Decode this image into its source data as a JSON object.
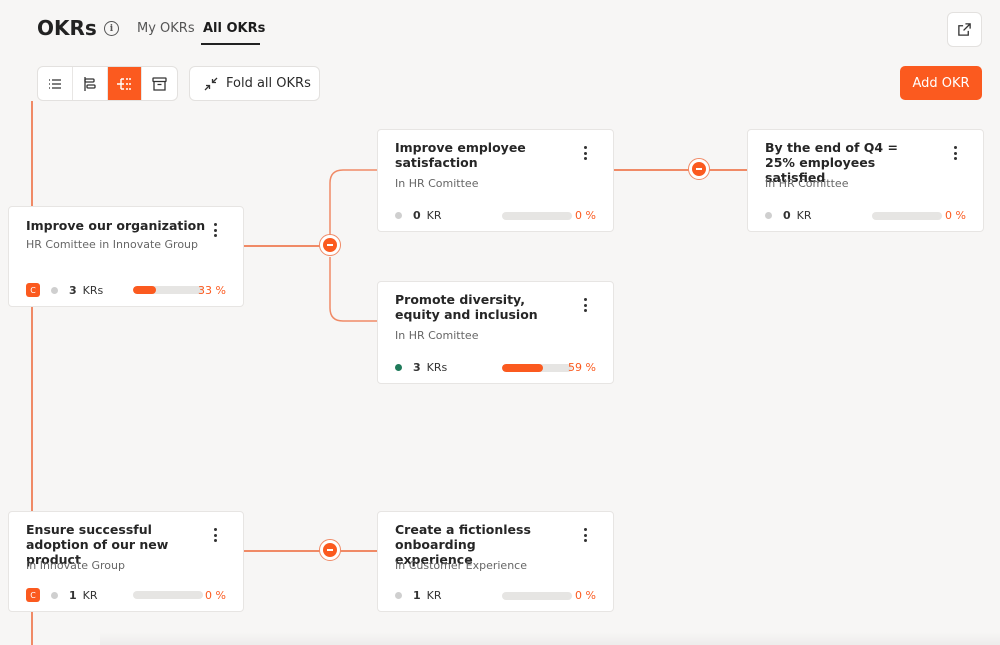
{
  "header": {
    "title": "OKRs",
    "info_icon": "i",
    "tabs": [
      {
        "label": "My OKRs"
      },
      {
        "label": "All OKRs",
        "active": true
      }
    ]
  },
  "toolbar": {
    "views": [
      "list-view-icon",
      "roadmap-view-icon",
      "tree-view-icon",
      "archive-icon"
    ],
    "active_view": "tree-view-icon",
    "fold_label": "Fold all OKRs",
    "add_label": "Add OKR"
  },
  "colors": {
    "accent": "#fb5a1f",
    "line": "#f08a66",
    "green": "#1f7a5a"
  },
  "cards": {
    "org": {
      "title": "Improve our organization",
      "sub": "HR Comittee in Innovate Group",
      "badge": "C",
      "kr_count": "3",
      "kr_label": "KRs",
      "progress": 0.33,
      "pct": "33 %",
      "status": "none"
    },
    "emp": {
      "title": "Improve employee satisfaction",
      "sub": "In HR Comittee",
      "kr_count": "0",
      "kr_label": "KR",
      "progress": 0,
      "pct": "0 %",
      "status": "none"
    },
    "q4": {
      "title": "By the end of Q4 = 25% employees satisfied",
      "sub": "In HR Comittee",
      "kr_count": "0",
      "kr_label": "KR",
      "progress": 0,
      "pct": "0 %",
      "status": "none"
    },
    "div": {
      "title": "Promote diversity, equity and inclusion",
      "sub": "In HR Comittee",
      "kr_count": "3",
      "kr_label": "KRs",
      "progress": 0.59,
      "pct": "59 %",
      "status": "green"
    },
    "adopt": {
      "title": "Ensure successful adoption of our new product",
      "sub": "In Innovate Group",
      "badge": "C",
      "kr_count": "1",
      "kr_label": "KR",
      "progress": 0,
      "pct": "0 %",
      "status": "none"
    },
    "onb": {
      "title": "Create a fictionless onboarding experience",
      "sub": "In Customer Experience",
      "kr_count": "1",
      "kr_label": "KR",
      "progress": 0,
      "pct": "0 %",
      "status": "none"
    }
  }
}
